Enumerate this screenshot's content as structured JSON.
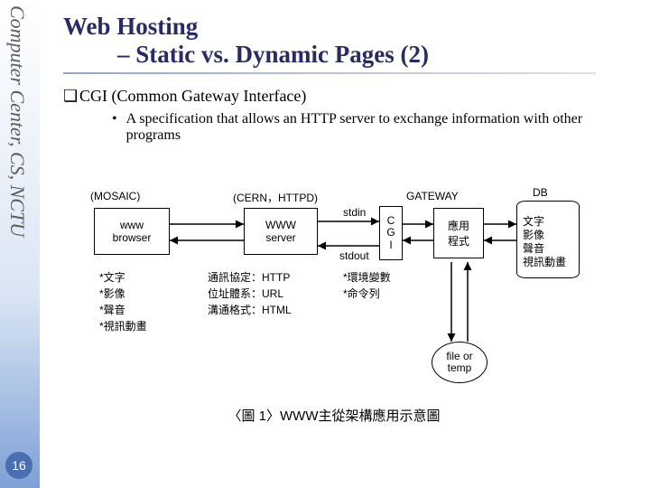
{
  "sidebar": {
    "org": "Computer Center, CS, NCTU",
    "page": "16"
  },
  "title": {
    "line1": "Web Hosting",
    "line2": "– Static vs. Dynamic Pages (2)"
  },
  "bullets": {
    "cgi_heading": "CGI (Common Gateway Interface)",
    "cgi_sub": "A specification that allows an HTTP server to exchange information with other programs"
  },
  "diagram": {
    "labels": {
      "mosaic": "(MOSAIC)",
      "cern": "(CERN，HTTPD)",
      "gateway": "GATEWAY",
      "db": "DB",
      "stdin": "stdin",
      "stdout": "stdout"
    },
    "box_browser_l1": "www",
    "box_browser_l2": "browser",
    "box_server_l1": "WWW",
    "box_server_l2": "server",
    "box_cgi_l1": "C",
    "box_cgi_l2": "G",
    "box_cgi_l3": "I",
    "box_app_l1": "應用",
    "box_app_l2": "程式",
    "box_db_l1": "文字",
    "box_db_l2": "影像",
    "box_db_l3": "聲音",
    "box_db_l4": "視訊動畫",
    "left_notes": {
      "a": "*文字",
      "b": "*影像",
      "c": "*聲音",
      "d": "*視訊動畫"
    },
    "mid_notes": {
      "a": "通訊協定：HTTP",
      "b": "位址體系：URL",
      "c": "溝通格式：HTML"
    },
    "right_notes": {
      "a": "*環境變數",
      "b": "*命令列"
    },
    "file_oval_l1": "file or",
    "file_oval_l2": "temp",
    "caption": "〈圖 1〉WWW主從架構應用示意圖"
  }
}
